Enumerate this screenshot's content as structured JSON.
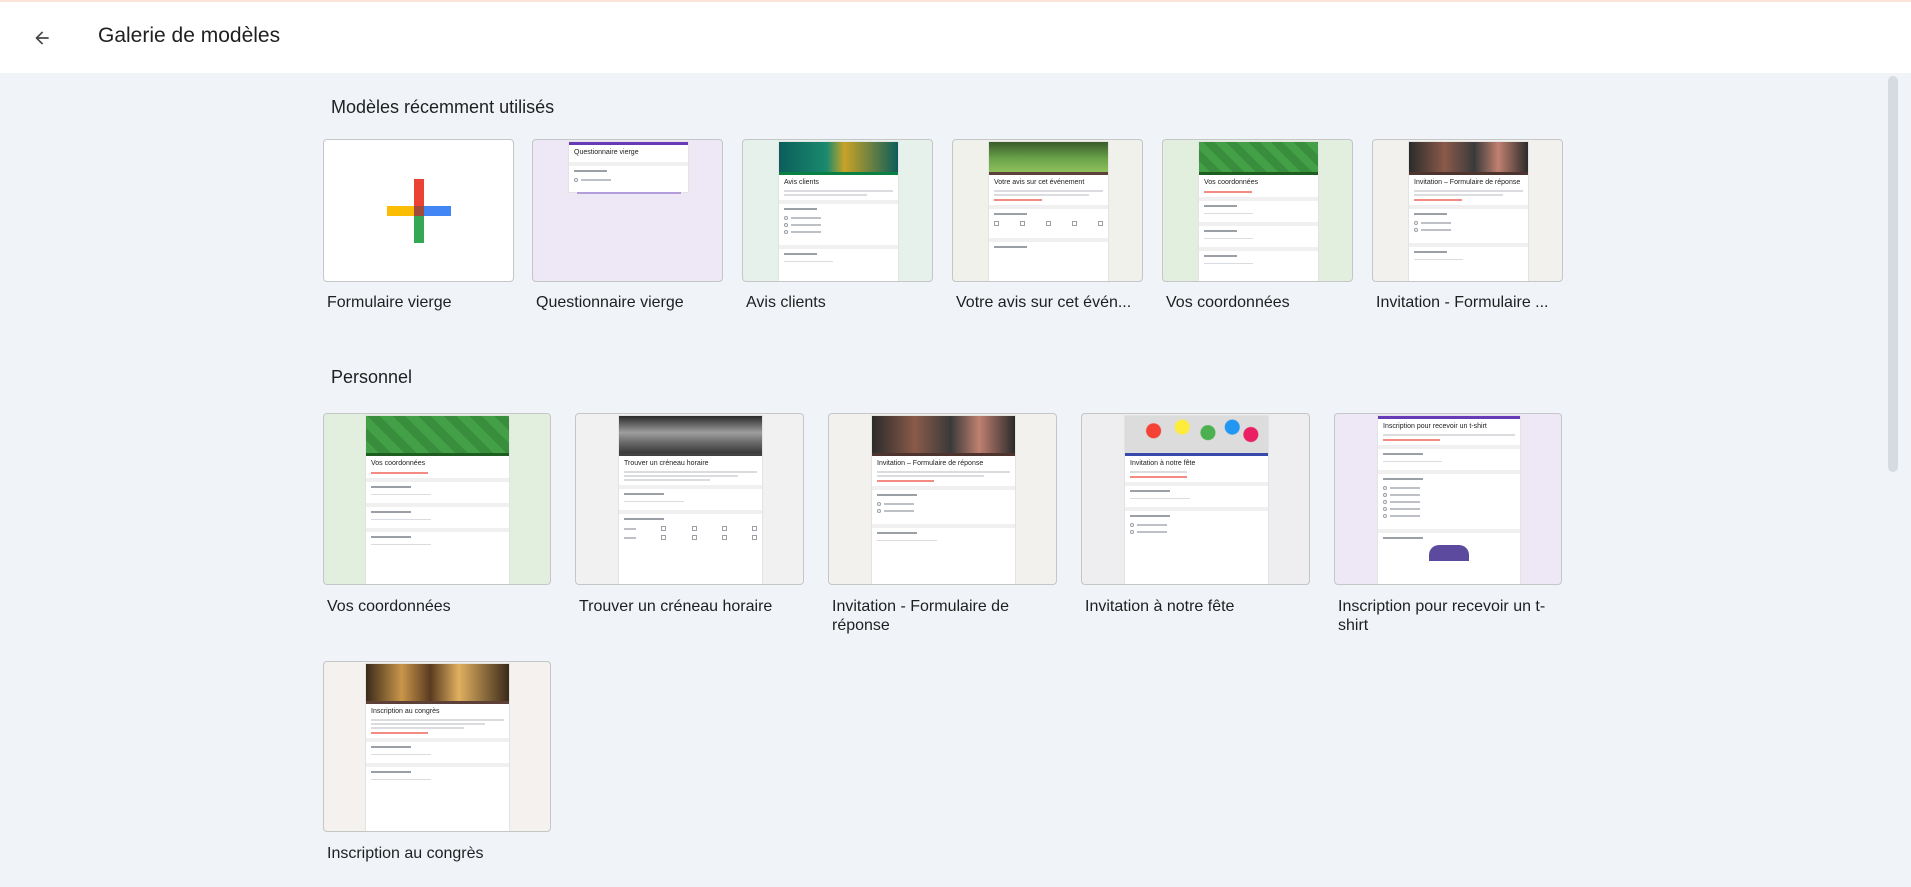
{
  "header": {
    "title": "Galerie de modèles"
  },
  "recent": {
    "title": "Modèles récemment utilisés",
    "items": [
      {
        "label": "Formulaire vierge"
      },
      {
        "label": "Questionnaire vierge"
      },
      {
        "label": "Avis clients"
      },
      {
        "label": "Votre avis sur cet évén..."
      },
      {
        "label": "Vos coordonnées"
      },
      {
        "label": "Invitation - Formulaire ..."
      }
    ]
  },
  "personal": {
    "title": "Personnel",
    "items": [
      {
        "label": "Vos coordonnées"
      },
      {
        "label": "Trouver un créneau horaire"
      },
      {
        "label": "Invitation - Formulaire de réponse"
      },
      {
        "label": "Invitation à notre fête"
      },
      {
        "label": "Inscription pour recevoir un t-shirt"
      },
      {
        "label": "Inscription au congrès"
      }
    ]
  },
  "thumbs": {
    "questionnaire_title": "Questionnaire vierge",
    "avis_title": "Avis clients",
    "event_title": "Votre avis sur cet événement",
    "coord_title": "Vos coordonnées",
    "invite_title": "Invitation – Formulaire de réponse",
    "creneau_title": "Trouver un créneau horaire",
    "fete_title": "Invitation à notre fête",
    "tshirt_title": "Inscription pour recevoir un t-shirt",
    "congres_title": "Inscription au congrès"
  },
  "colors": {
    "background": "#f0f4f9",
    "plus_red": "#ea4335",
    "plus_blue": "#4285f4",
    "plus_yellow": "#fbbc04",
    "plus_green": "#34a853",
    "purple_theme": "#673ab7",
    "green_theme": "#1e8e3e",
    "teal_theme": "#0b8043"
  }
}
